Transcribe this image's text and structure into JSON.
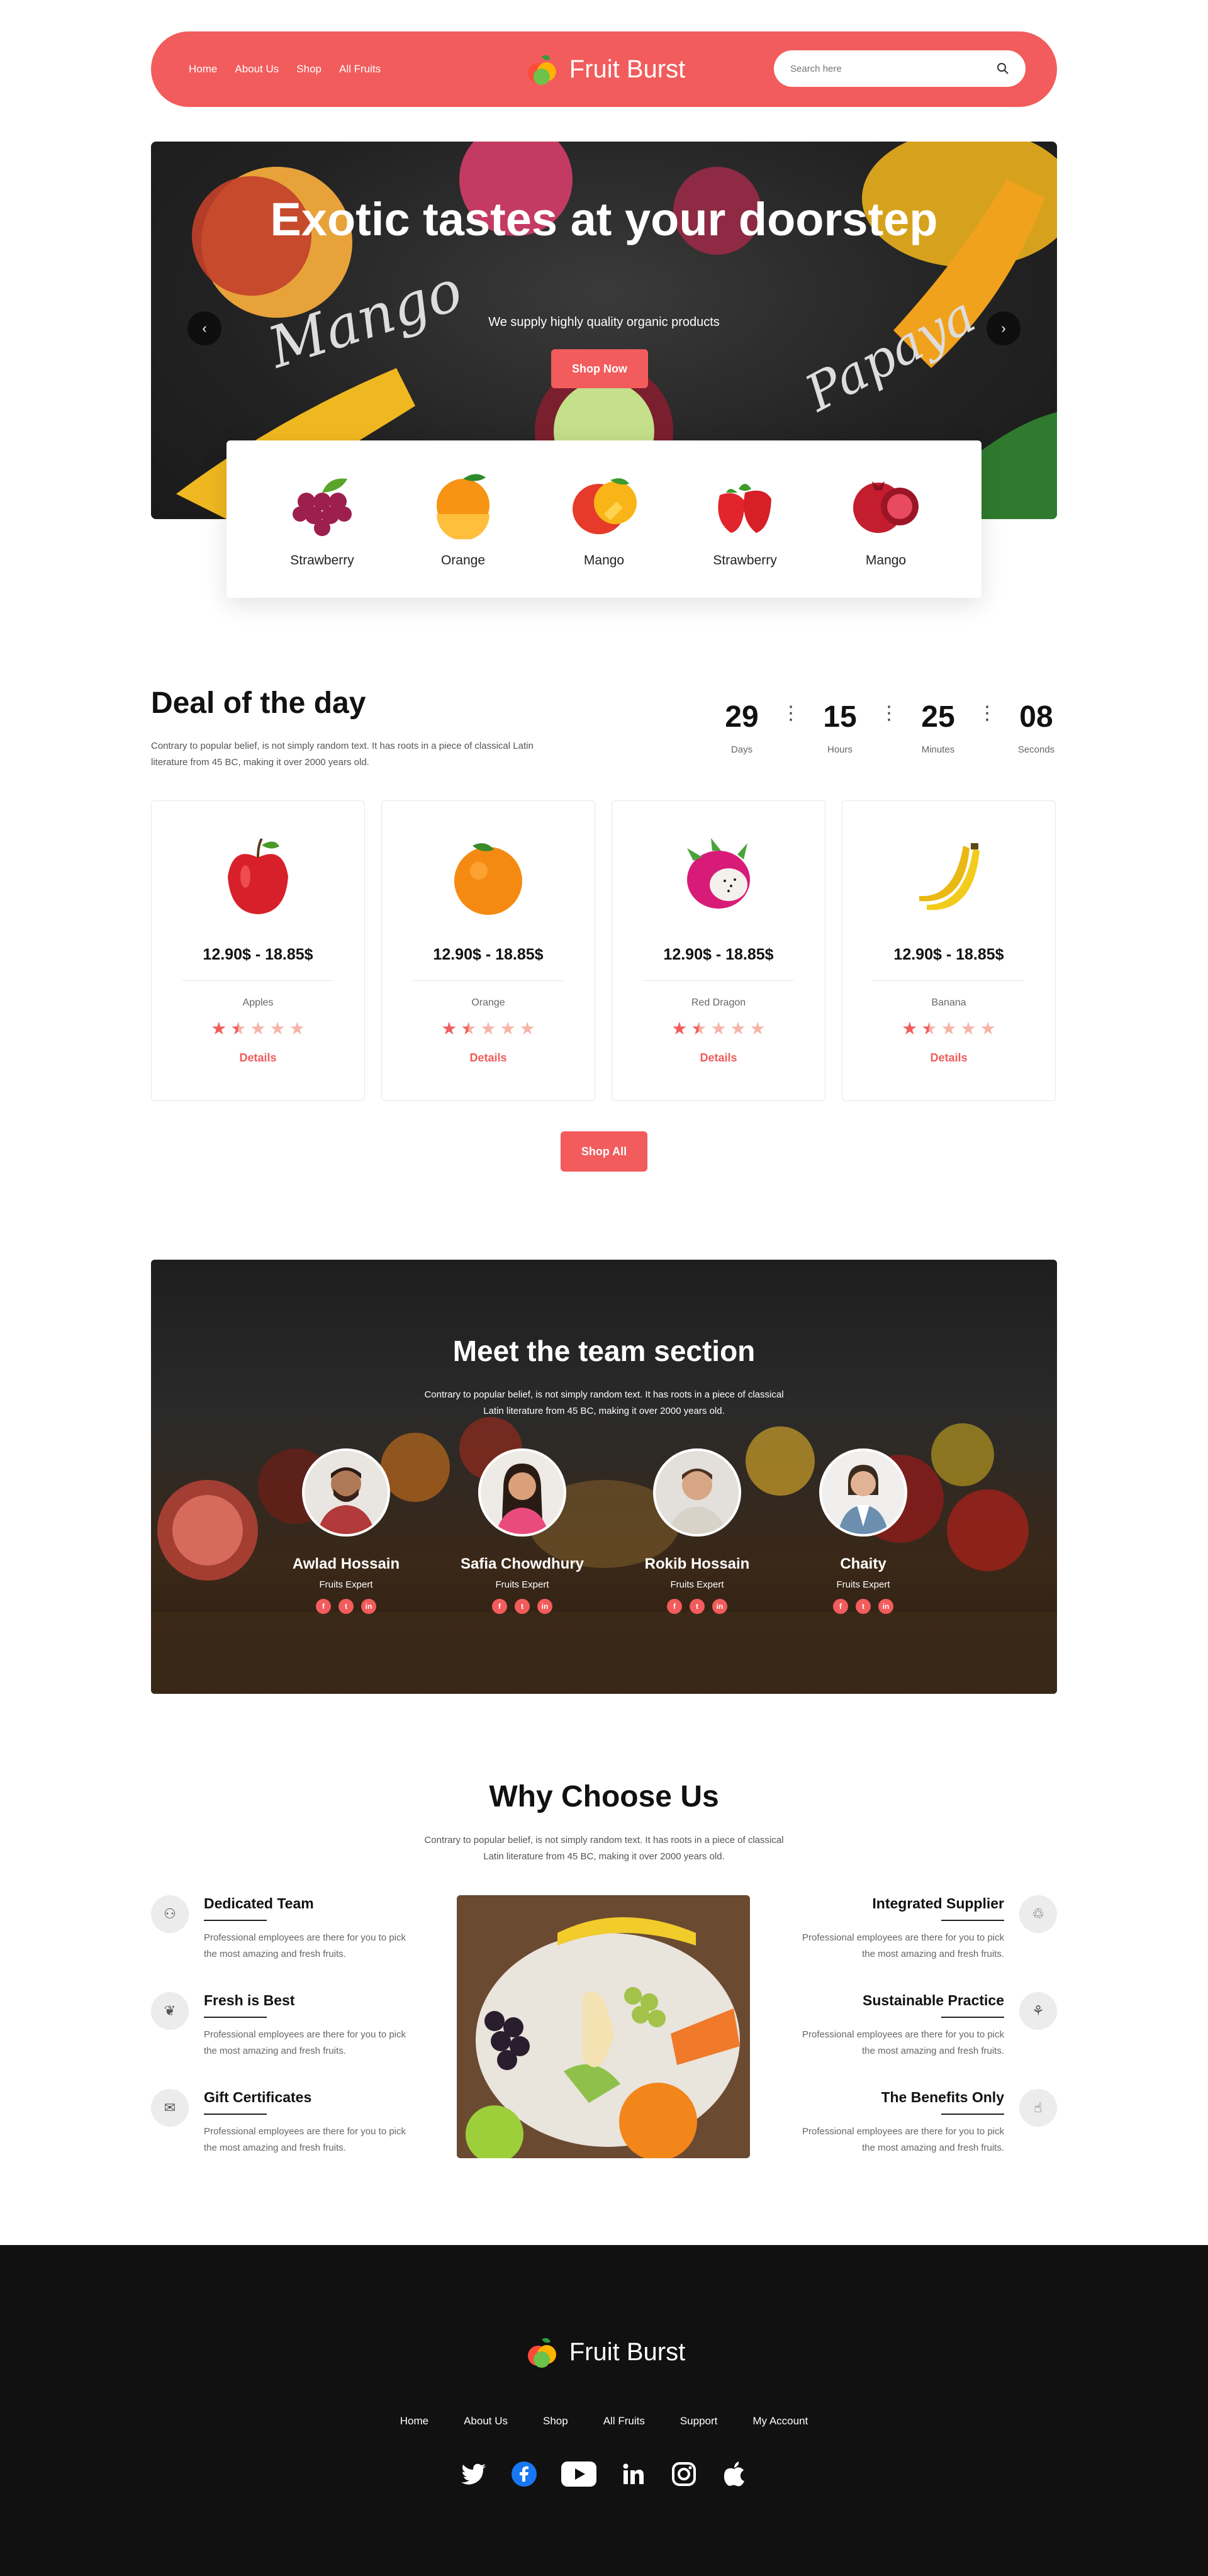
{
  "header": {
    "nav": [
      "Home",
      "About Us",
      "Shop",
      "All Fruits"
    ],
    "brand": "Fruit Burst",
    "search_placeholder": "Search here"
  },
  "hero": {
    "title": "Exotic tastes at your doorstep",
    "subtitle": "We supply highly quality organic products",
    "button": "Shop Now"
  },
  "categories": [
    {
      "label": "Strawberry",
      "icon": "grapes-icon"
    },
    {
      "label": "Orange",
      "icon": "orange-icon"
    },
    {
      "label": "Mango",
      "icon": "mango-icon"
    },
    {
      "label": "Strawberry",
      "icon": "strawberry-icon"
    },
    {
      "label": "Mango",
      "icon": "pomegranate-icon"
    }
  ],
  "deal": {
    "title": "Deal of the day",
    "description": "Contrary to popular belief, is not simply random text. It has roots in a piece of classical Latin literature from 45 BC, making it over 2000 years old.",
    "countdown": [
      {
        "value": "29",
        "label": "Days"
      },
      {
        "value": "15",
        "label": "Hours"
      },
      {
        "value": "25",
        "label": "Minutes"
      },
      {
        "value": "08",
        "label": "Seconds"
      }
    ],
    "products": [
      {
        "price": "12.90$ - 18.85$",
        "name": "Apples",
        "rating": 1.5,
        "details": "Details",
        "icon": "apple-icon"
      },
      {
        "price": "12.90$ - 18.85$",
        "name": "Orange",
        "rating": 1.5,
        "details": "Details",
        "icon": "orange-icon"
      },
      {
        "price": "12.90$ - 18.85$",
        "name": "Red Dragon",
        "rating": 1.5,
        "details": "Details",
        "icon": "dragonfruit-icon"
      },
      {
        "price": "12.90$ - 18.85$",
        "name": "Banana",
        "rating": 1.5,
        "details": "Details",
        "icon": "banana-icon"
      }
    ],
    "shop_all": "Shop All"
  },
  "team": {
    "title": "Meet the team section",
    "description": "Contrary to popular belief, is not simply random text. It has roots in a piece of classical Latin literature from 45 BC, making it over 2000 years old.",
    "members": [
      {
        "name": "Awlad Hossain",
        "role": "Fruits Expert"
      },
      {
        "name": "Safia Chowdhury",
        "role": "Fruits Expert"
      },
      {
        "name": "Rokib Hossain",
        "role": "Fruits Expert"
      },
      {
        "name": "Chaity",
        "role": "Fruits Expert"
      }
    ],
    "social": [
      "f",
      "t",
      "in"
    ]
  },
  "why": {
    "title": "Why Choose Us",
    "description": "Contrary to popular belief, is not simply random text. It has roots in a piece of classical Latin literature from 45 BC, making it over 2000 years old.",
    "features_left": [
      {
        "title": "Dedicated Team",
        "text": "Professional employees are there for you to pick the most amazing and fresh fruits."
      },
      {
        "title": "Fresh is Best",
        "text": "Professional employees are there for you to pick the most amazing and fresh fruits."
      },
      {
        "title": "Gift Certificates",
        "text": "Professional employees are there for you to pick the most amazing and fresh fruits."
      }
    ],
    "features_right": [
      {
        "title": "Integrated Supplier",
        "text": "Professional employees are there for you to pick the most amazing and fresh fruits."
      },
      {
        "title": "Sustainable Practice",
        "text": "Professional employees are there for you to pick the most amazing and fresh fruits."
      },
      {
        "title": "The Benefits Only",
        "text": "Professional employees are there for you to pick the most amazing and fresh fruits."
      }
    ]
  },
  "footer": {
    "brand": "Fruit Burst",
    "nav": [
      "Home",
      "About Us",
      "Shop",
      "All Fruits",
      "Support",
      "My Account"
    ],
    "social_icons": [
      "twitter-icon",
      "facebook-icon",
      "youtube-icon",
      "linkedin-icon",
      "instagram-icon",
      "apple-icon"
    ]
  },
  "colors": {
    "accent": "#f25c5c",
    "dark": "#111111"
  }
}
